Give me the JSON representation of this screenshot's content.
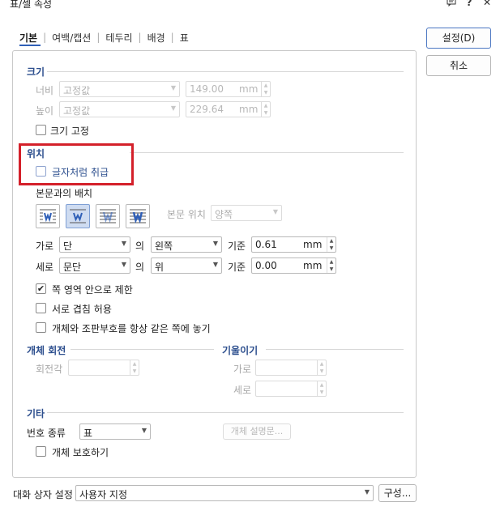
{
  "window": {
    "title": "표/셀 속성",
    "comment_icon": "comment-icon",
    "help_label": "?",
    "close_label": "✕"
  },
  "tabs": [
    {
      "label": "기본"
    },
    {
      "label": "여백/캡션"
    },
    {
      "label": "테두리"
    },
    {
      "label": "배경"
    },
    {
      "label": "표"
    }
  ],
  "buttons": {
    "ok": "설정(D)",
    "cancel": "취소"
  },
  "size": {
    "title": "크기",
    "width_label": "너비",
    "width_mode": "고정값",
    "width_value": "149.00",
    "width_unit": "mm",
    "height_label": "높이",
    "height_mode": "고정값",
    "height_value": "229.64",
    "height_unit": "mm",
    "fixed_label": "크기 고정",
    "fixed_checked": false
  },
  "position": {
    "title": "위치",
    "treat_as_char_label": "글자처럼 취급",
    "treat_as_char_checked": false,
    "wrap_label": "본문과의 배치",
    "body_pos_label": "본문 위치",
    "body_pos_value": "양쪽",
    "horiz_label": "가로",
    "horiz_ref": "단",
    "horiz_of": "의",
    "horiz_align": "왼쪽",
    "horiz_base_label": "기준",
    "horiz_value": "0.61",
    "horiz_unit": "mm",
    "vert_label": "세로",
    "vert_ref": "문단",
    "vert_of": "의",
    "vert_align": "위",
    "vert_base_label": "기준",
    "vert_value": "0.00",
    "vert_unit": "mm",
    "limit_label": "쪽 영역 안으로 제한",
    "limit_checked": true,
    "overlap_label": "서로 겹침 허용",
    "overlap_checked": false,
    "same_page_label": "개체와 조판부호를 항상 같은 쪽에 놓기",
    "same_page_checked": false
  },
  "rotation": {
    "title": "개체 회전",
    "angle_label": "회전각"
  },
  "skew": {
    "title": "기울이기",
    "horiz_label": "가로",
    "vert_label": "세로"
  },
  "other": {
    "title": "기타",
    "number_type_label": "번호 종류",
    "number_type_value": "표",
    "description_button": "개체 설명문...",
    "protect_label": "개체 보호하기",
    "protect_checked": false
  },
  "footer": {
    "dialog_setting_label": "대화 상자 설정",
    "dialog_setting_value": "사용자 지정",
    "config_button": "구성..."
  },
  "colors": {
    "accent": "#2f5fb7",
    "section_title": "#2d4f8e",
    "highlight_box": "#d4202a"
  }
}
